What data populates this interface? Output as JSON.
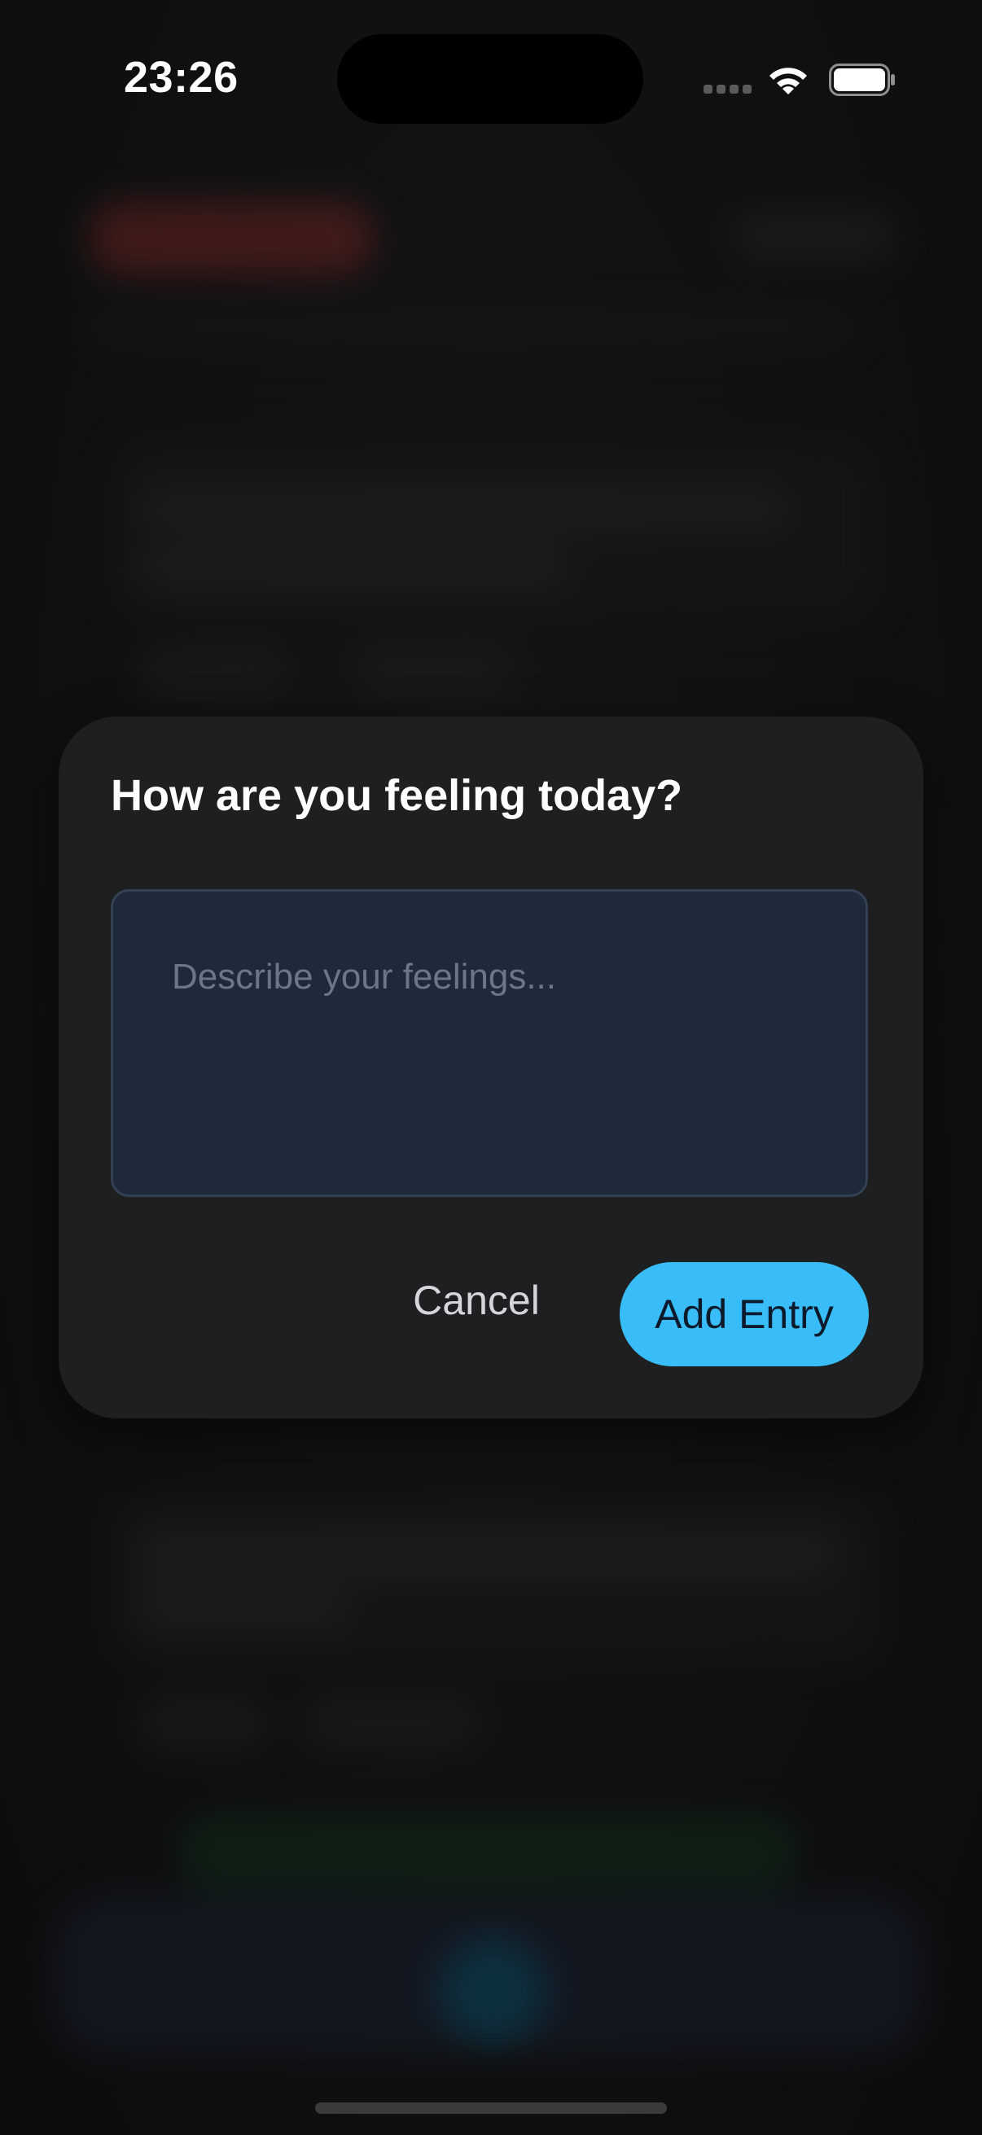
{
  "status_bar": {
    "time": "23:26",
    "signal_icon": "cellular-signal-icon",
    "wifi_icon": "wifi-icon",
    "battery_icon": "battery-icon"
  },
  "dialog": {
    "title": "How are you feeling today?",
    "input": {
      "value": "",
      "placeholder": "Describe your feelings..."
    },
    "cancel_label": "Cancel",
    "add_label": "Add Entry"
  },
  "colors": {
    "accent": "#38bdf8",
    "dialog_background": "#1e1f20",
    "input_background": "#1e293b",
    "input_border": "#334155"
  }
}
